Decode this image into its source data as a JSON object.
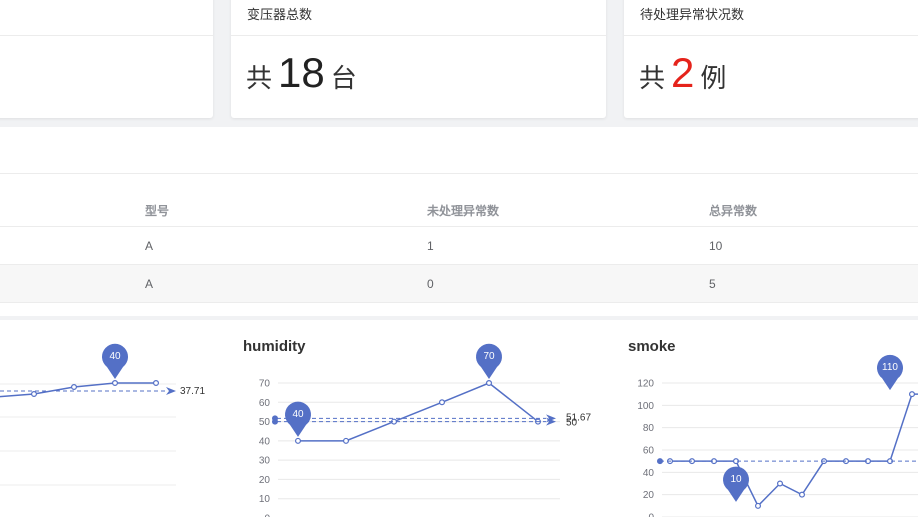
{
  "cards": [
    {
      "title": "变压器总数",
      "prefix": "共",
      "value": "18",
      "suffix": "台"
    },
    {
      "title": "待处理异常状况数",
      "prefix": "共",
      "value": "2",
      "suffix": "例"
    }
  ],
  "table": {
    "headers": [
      "型号",
      "未处理异常数",
      "总异常数"
    ],
    "rows": [
      [
        "A",
        "1",
        "10"
      ],
      [
        "A",
        "0",
        "5"
      ]
    ]
  },
  "colors": {
    "accent": "#5470c6",
    "red": "#e5231b"
  },
  "chart_data": [
    {
      "type": "line",
      "title": "",
      "max_marker": "40",
      "avg_label": "37.71",
      "values": [
        36,
        37,
        38,
        39,
        40,
        40
      ]
    },
    {
      "type": "line",
      "title": "humidity",
      "yticks": [
        "70",
        "60",
        "50",
        "40",
        "30",
        "20",
        "10",
        "0"
      ],
      "ylim": [
        0,
        70
      ],
      "values": [
        40,
        40,
        50,
        60,
        70,
        50
      ],
      "max_marker": "70",
      "min_marker": "40",
      "avg_label": "51.67",
      "avg_value": 51.67,
      "second_line_label": "50",
      "second_line_value": 50
    },
    {
      "type": "line",
      "title": "smoke",
      "yticks": [
        "120",
        "100",
        "80",
        "60",
        "40",
        "20",
        "0"
      ],
      "ylim": [
        0,
        120
      ],
      "values": [
        50,
        50,
        50,
        50,
        10,
        30,
        20,
        50,
        50,
        50,
        50,
        110,
        110,
        50
      ],
      "max_marker": "110",
      "min_marker": "10",
      "avg_value": 50
    }
  ]
}
